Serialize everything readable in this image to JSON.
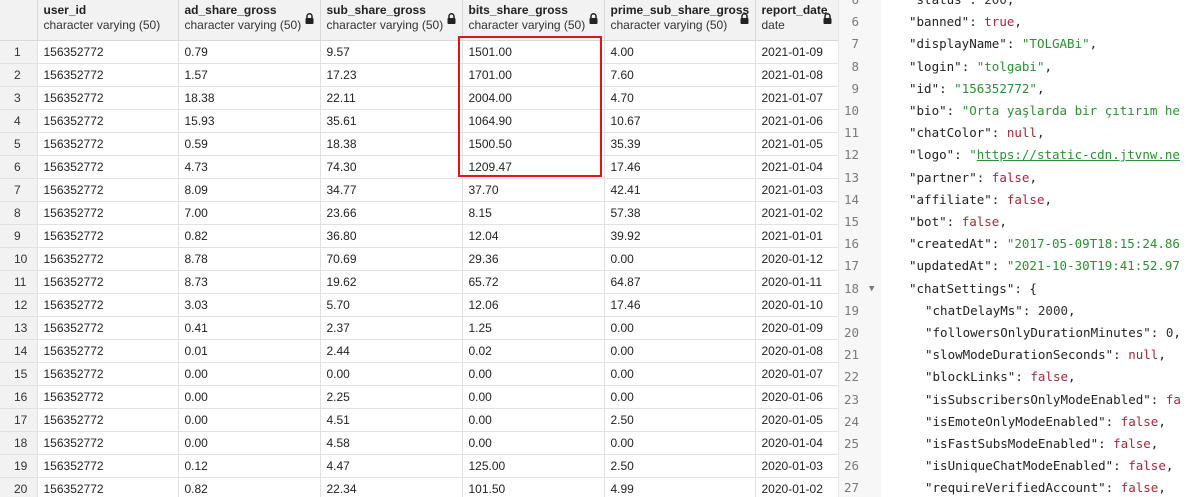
{
  "table": {
    "columns": [
      {
        "name": "user_id",
        "type": "character varying (50)",
        "locked": false
      },
      {
        "name": "ad_share_gross",
        "type": "character varying (50)",
        "locked": true
      },
      {
        "name": "sub_share_gross",
        "type": "character varying (50)",
        "locked": true
      },
      {
        "name": "bits_share_gross",
        "type": "character varying (50)",
        "locked": true
      },
      {
        "name": "prime_sub_share_gross",
        "type": "character varying (50)",
        "locked": true
      },
      {
        "name": "report_date",
        "type": "date",
        "locked": true
      }
    ],
    "rows": [
      [
        "1",
        "156352772",
        "0.79",
        "9.57",
        "1501.00",
        "4.00",
        "2021-01-09"
      ],
      [
        "2",
        "156352772",
        "1.57",
        "17.23",
        "1701.00",
        "7.60",
        "2021-01-08"
      ],
      [
        "3",
        "156352772",
        "18.38",
        "22.11",
        "2004.00",
        "4.70",
        "2021-01-07"
      ],
      [
        "4",
        "156352772",
        "15.93",
        "35.61",
        "1064.90",
        "10.67",
        "2021-01-06"
      ],
      [
        "5",
        "156352772",
        "0.59",
        "18.38",
        "1500.50",
        "35.39",
        "2021-01-05"
      ],
      [
        "6",
        "156352772",
        "4.73",
        "74.30",
        "1209.47",
        "17.46",
        "2021-01-04"
      ],
      [
        "7",
        "156352772",
        "8.09",
        "34.77",
        "37.70",
        "42.41",
        "2021-01-03"
      ],
      [
        "8",
        "156352772",
        "7.00",
        "23.66",
        "8.15",
        "57.38",
        "2021-01-02"
      ],
      [
        "9",
        "156352772",
        "0.82",
        "36.80",
        "12.04",
        "39.92",
        "2021-01-01"
      ],
      [
        "10",
        "156352772",
        "8.78",
        "70.69",
        "29.36",
        "0.00",
        "2020-01-12"
      ],
      [
        "11",
        "156352772",
        "8.73",
        "19.62",
        "65.72",
        "64.87",
        "2020-01-11"
      ],
      [
        "12",
        "156352772",
        "3.03",
        "5.70",
        "12.06",
        "17.46",
        "2020-01-10"
      ],
      [
        "13",
        "156352772",
        "0.41",
        "2.37",
        "1.25",
        "0.00",
        "2020-01-09"
      ],
      [
        "14",
        "156352772",
        "0.01",
        "2.44",
        "0.02",
        "0.00",
        "2020-01-08"
      ],
      [
        "15",
        "156352772",
        "0.00",
        "0.00",
        "0.00",
        "0.00",
        "2020-01-07"
      ],
      [
        "16",
        "156352772",
        "0.00",
        "2.25",
        "0.00",
        "0.00",
        "2020-01-06"
      ],
      [
        "17",
        "156352772",
        "0.00",
        "4.51",
        "0.00",
        "2.50",
        "2020-01-05"
      ],
      [
        "18",
        "156352772",
        "0.00",
        "4.58",
        "0.00",
        "0.00",
        "2020-01-04"
      ],
      [
        "19",
        "156352772",
        "0.12",
        "4.47",
        "125.00",
        "2.50",
        "2020-01-03"
      ],
      [
        "20",
        "156352772",
        "0.82",
        "22.34",
        "101.50",
        "4.99",
        "2020-01-02"
      ]
    ],
    "highlight_color": "#e0151b"
  },
  "json_viewer": {
    "lines": [
      {
        "n": "6",
        "fold": "",
        "indent": 1,
        "tokens": [
          [
            "k",
            "\"status\""
          ],
          [
            "p",
            ": "
          ],
          [
            "n",
            "200"
          ],
          [
            "p",
            ","
          ]
        ]
      },
      {
        "n": "6",
        "fold": "",
        "indent": 1,
        "tokens": [
          [
            "k",
            "\"banned\""
          ],
          [
            "p",
            ": "
          ],
          [
            "b",
            "true"
          ],
          [
            "p",
            ","
          ]
        ]
      },
      {
        "n": "7",
        "fold": "",
        "indent": 1,
        "tokens": [
          [
            "k",
            "\"displayName\""
          ],
          [
            "p",
            ": "
          ],
          [
            "s",
            "\"TOLGABi\""
          ],
          [
            "p",
            ","
          ]
        ]
      },
      {
        "n": "8",
        "fold": "",
        "indent": 1,
        "tokens": [
          [
            "k",
            "\"login\""
          ],
          [
            "p",
            ": "
          ],
          [
            "s",
            "\"tolgabi\""
          ],
          [
            "p",
            ","
          ]
        ]
      },
      {
        "n": "9",
        "fold": "",
        "indent": 1,
        "tokens": [
          [
            "k",
            "\"id\""
          ],
          [
            "p",
            ": "
          ],
          [
            "s",
            "\"156352772\""
          ],
          [
            "p",
            ","
          ]
        ]
      },
      {
        "n": "10",
        "fold": "",
        "indent": 1,
        "tokens": [
          [
            "k",
            "\"bio\""
          ],
          [
            "p",
            ": "
          ],
          [
            "s",
            "\"Orta yaşlarda bir çıtırım he"
          ]
        ]
      },
      {
        "n": "11",
        "fold": "",
        "indent": 1,
        "tokens": [
          [
            "k",
            "\"chatColor\""
          ],
          [
            "p",
            ": "
          ],
          [
            "b",
            "null"
          ],
          [
            "p",
            ","
          ]
        ]
      },
      {
        "n": "12",
        "fold": "",
        "indent": 1,
        "tokens": [
          [
            "k",
            "\"logo\""
          ],
          [
            "p",
            ": "
          ],
          [
            "s",
            "\""
          ],
          [
            "u",
            "https://static-cdn.jtvnw.ne"
          ]
        ]
      },
      {
        "n": "13",
        "fold": "",
        "indent": 1,
        "tokens": [
          [
            "k",
            "\"partner\""
          ],
          [
            "p",
            ": "
          ],
          [
            "b",
            "false"
          ],
          [
            "p",
            ","
          ]
        ]
      },
      {
        "n": "14",
        "fold": "",
        "indent": 1,
        "tokens": [
          [
            "k",
            "\"affiliate\""
          ],
          [
            "p",
            ": "
          ],
          [
            "b",
            "false"
          ],
          [
            "p",
            ","
          ]
        ]
      },
      {
        "n": "15",
        "fold": "",
        "indent": 1,
        "tokens": [
          [
            "k",
            "\"bot\""
          ],
          [
            "p",
            ": "
          ],
          [
            "b",
            "false"
          ],
          [
            "p",
            ","
          ]
        ]
      },
      {
        "n": "16",
        "fold": "",
        "indent": 1,
        "tokens": [
          [
            "k",
            "\"createdAt\""
          ],
          [
            "p",
            ": "
          ],
          [
            "s",
            "\"2017-05-09T18:15:24.86"
          ]
        ]
      },
      {
        "n": "17",
        "fold": "",
        "indent": 1,
        "tokens": [
          [
            "k",
            "\"updatedAt\""
          ],
          [
            "p",
            ": "
          ],
          [
            "s",
            "\"2021-10-30T19:41:52.97"
          ]
        ]
      },
      {
        "n": "18",
        "fold": "▼",
        "indent": 1,
        "tokens": [
          [
            "k",
            "\"chatSettings\""
          ],
          [
            "p",
            ": {"
          ]
        ]
      },
      {
        "n": "19",
        "fold": "",
        "indent": 2,
        "tokens": [
          [
            "k",
            "\"chatDelayMs\""
          ],
          [
            "p",
            ": "
          ],
          [
            "n",
            "2000"
          ],
          [
            "p",
            ","
          ]
        ]
      },
      {
        "n": "20",
        "fold": "",
        "indent": 2,
        "tokens": [
          [
            "k",
            "\"followersOnlyDurationMinutes\""
          ],
          [
            "p",
            ": "
          ],
          [
            "n",
            "0"
          ],
          [
            "p",
            ","
          ]
        ]
      },
      {
        "n": "21",
        "fold": "",
        "indent": 2,
        "tokens": [
          [
            "k",
            "\"slowModeDurationSeconds\""
          ],
          [
            "p",
            ": "
          ],
          [
            "b",
            "null"
          ],
          [
            "p",
            ","
          ]
        ]
      },
      {
        "n": "22",
        "fold": "",
        "indent": 2,
        "tokens": [
          [
            "k",
            "\"blockLinks\""
          ],
          [
            "p",
            ": "
          ],
          [
            "b",
            "false"
          ],
          [
            "p",
            ","
          ]
        ]
      },
      {
        "n": "23",
        "fold": "",
        "indent": 2,
        "tokens": [
          [
            "k",
            "\"isSubscribersOnlyModeEnabled\""
          ],
          [
            "p",
            ": "
          ],
          [
            "b",
            "fa"
          ]
        ]
      },
      {
        "n": "24",
        "fold": "",
        "indent": 2,
        "tokens": [
          [
            "k",
            "\"isEmoteOnlyModeEnabled\""
          ],
          [
            "p",
            ": "
          ],
          [
            "b",
            "false"
          ],
          [
            "p",
            ","
          ]
        ]
      },
      {
        "n": "25",
        "fold": "",
        "indent": 2,
        "tokens": [
          [
            "k",
            "\"isFastSubsModeEnabled\""
          ],
          [
            "p",
            ": "
          ],
          [
            "b",
            "false"
          ],
          [
            "p",
            ","
          ]
        ]
      },
      {
        "n": "26",
        "fold": "",
        "indent": 2,
        "tokens": [
          [
            "k",
            "\"isUniqueChatModeEnabled\""
          ],
          [
            "p",
            ": "
          ],
          [
            "b",
            "false"
          ],
          [
            "p",
            ","
          ]
        ]
      },
      {
        "n": "27",
        "fold": "",
        "indent": 2,
        "tokens": [
          [
            "k",
            "\"requireVerifiedAccount\""
          ],
          [
            "p",
            ": "
          ],
          [
            "b",
            "false"
          ],
          [
            "p",
            ","
          ]
        ]
      }
    ]
  }
}
